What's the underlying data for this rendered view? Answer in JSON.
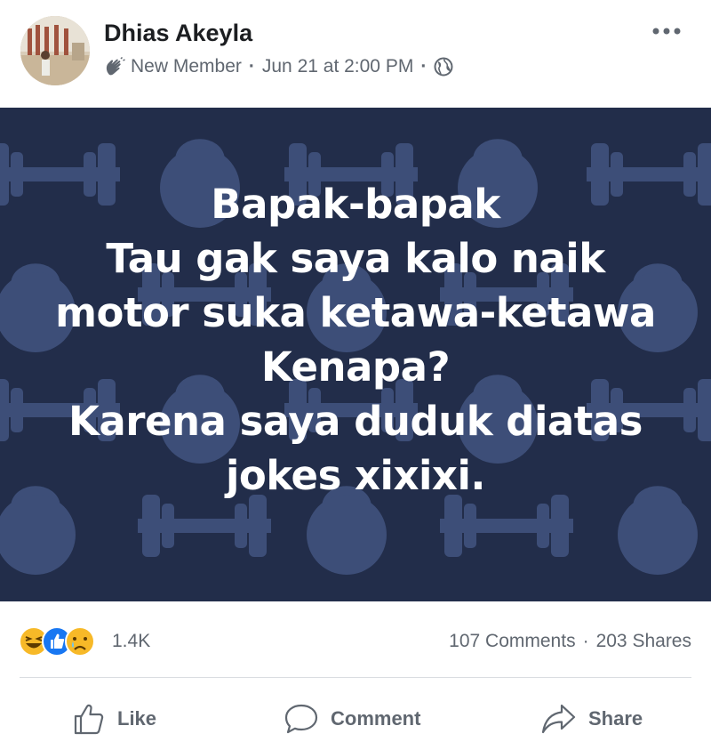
{
  "post": {
    "author": "Dhias Akeyla",
    "badge_label": "New Member",
    "timestamp": "Jun 21 at 2:00 PM",
    "privacy_icon": "globe-icon",
    "more_icon": "more-options-icon"
  },
  "image": {
    "lines": [
      "Bapak-bapak",
      "Tau gak saya kalo naik",
      "motor suka ketawa-ketawa",
      "Kenapa?",
      "Karena saya duduk diatas",
      "jokes xixixi."
    ],
    "colors": {
      "background": "#222d4a",
      "pattern": "#3d4e78",
      "text": "#ffffff"
    }
  },
  "stats": {
    "reactions": [
      "laugh-reaction-icon",
      "like-reaction-icon",
      "sad-reaction-icon"
    ],
    "reaction_count": "1.4K",
    "comments": "107 Comments",
    "shares": "203 Shares"
  },
  "actions": {
    "like": "Like",
    "comment": "Comment",
    "share": "Share"
  }
}
